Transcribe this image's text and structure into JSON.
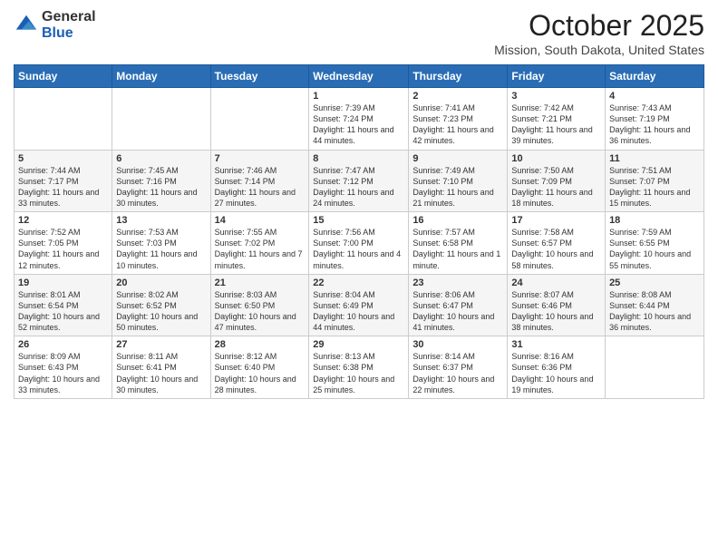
{
  "header": {
    "logo_general": "General",
    "logo_blue": "Blue",
    "month_title": "October 2025",
    "location": "Mission, South Dakota, United States"
  },
  "days_of_week": [
    "Sunday",
    "Monday",
    "Tuesday",
    "Wednesday",
    "Thursday",
    "Friday",
    "Saturday"
  ],
  "weeks": [
    [
      {
        "num": "",
        "info": ""
      },
      {
        "num": "",
        "info": ""
      },
      {
        "num": "",
        "info": ""
      },
      {
        "num": "1",
        "info": "Sunrise: 7:39 AM\nSunset: 7:24 PM\nDaylight: 11 hours and 44 minutes."
      },
      {
        "num": "2",
        "info": "Sunrise: 7:41 AM\nSunset: 7:23 PM\nDaylight: 11 hours and 42 minutes."
      },
      {
        "num": "3",
        "info": "Sunrise: 7:42 AM\nSunset: 7:21 PM\nDaylight: 11 hours and 39 minutes."
      },
      {
        "num": "4",
        "info": "Sunrise: 7:43 AM\nSunset: 7:19 PM\nDaylight: 11 hours and 36 minutes."
      }
    ],
    [
      {
        "num": "5",
        "info": "Sunrise: 7:44 AM\nSunset: 7:17 PM\nDaylight: 11 hours and 33 minutes."
      },
      {
        "num": "6",
        "info": "Sunrise: 7:45 AM\nSunset: 7:16 PM\nDaylight: 11 hours and 30 minutes."
      },
      {
        "num": "7",
        "info": "Sunrise: 7:46 AM\nSunset: 7:14 PM\nDaylight: 11 hours and 27 minutes."
      },
      {
        "num": "8",
        "info": "Sunrise: 7:47 AM\nSunset: 7:12 PM\nDaylight: 11 hours and 24 minutes."
      },
      {
        "num": "9",
        "info": "Sunrise: 7:49 AM\nSunset: 7:10 PM\nDaylight: 11 hours and 21 minutes."
      },
      {
        "num": "10",
        "info": "Sunrise: 7:50 AM\nSunset: 7:09 PM\nDaylight: 11 hours and 18 minutes."
      },
      {
        "num": "11",
        "info": "Sunrise: 7:51 AM\nSunset: 7:07 PM\nDaylight: 11 hours and 15 minutes."
      }
    ],
    [
      {
        "num": "12",
        "info": "Sunrise: 7:52 AM\nSunset: 7:05 PM\nDaylight: 11 hours and 12 minutes."
      },
      {
        "num": "13",
        "info": "Sunrise: 7:53 AM\nSunset: 7:03 PM\nDaylight: 11 hours and 10 minutes."
      },
      {
        "num": "14",
        "info": "Sunrise: 7:55 AM\nSunset: 7:02 PM\nDaylight: 11 hours and 7 minutes."
      },
      {
        "num": "15",
        "info": "Sunrise: 7:56 AM\nSunset: 7:00 PM\nDaylight: 11 hours and 4 minutes."
      },
      {
        "num": "16",
        "info": "Sunrise: 7:57 AM\nSunset: 6:58 PM\nDaylight: 11 hours and 1 minute."
      },
      {
        "num": "17",
        "info": "Sunrise: 7:58 AM\nSunset: 6:57 PM\nDaylight: 10 hours and 58 minutes."
      },
      {
        "num": "18",
        "info": "Sunrise: 7:59 AM\nSunset: 6:55 PM\nDaylight: 10 hours and 55 minutes."
      }
    ],
    [
      {
        "num": "19",
        "info": "Sunrise: 8:01 AM\nSunset: 6:54 PM\nDaylight: 10 hours and 52 minutes."
      },
      {
        "num": "20",
        "info": "Sunrise: 8:02 AM\nSunset: 6:52 PM\nDaylight: 10 hours and 50 minutes."
      },
      {
        "num": "21",
        "info": "Sunrise: 8:03 AM\nSunset: 6:50 PM\nDaylight: 10 hours and 47 minutes."
      },
      {
        "num": "22",
        "info": "Sunrise: 8:04 AM\nSunset: 6:49 PM\nDaylight: 10 hours and 44 minutes."
      },
      {
        "num": "23",
        "info": "Sunrise: 8:06 AM\nSunset: 6:47 PM\nDaylight: 10 hours and 41 minutes."
      },
      {
        "num": "24",
        "info": "Sunrise: 8:07 AM\nSunset: 6:46 PM\nDaylight: 10 hours and 38 minutes."
      },
      {
        "num": "25",
        "info": "Sunrise: 8:08 AM\nSunset: 6:44 PM\nDaylight: 10 hours and 36 minutes."
      }
    ],
    [
      {
        "num": "26",
        "info": "Sunrise: 8:09 AM\nSunset: 6:43 PM\nDaylight: 10 hours and 33 minutes."
      },
      {
        "num": "27",
        "info": "Sunrise: 8:11 AM\nSunset: 6:41 PM\nDaylight: 10 hours and 30 minutes."
      },
      {
        "num": "28",
        "info": "Sunrise: 8:12 AM\nSunset: 6:40 PM\nDaylight: 10 hours and 28 minutes."
      },
      {
        "num": "29",
        "info": "Sunrise: 8:13 AM\nSunset: 6:38 PM\nDaylight: 10 hours and 25 minutes."
      },
      {
        "num": "30",
        "info": "Sunrise: 8:14 AM\nSunset: 6:37 PM\nDaylight: 10 hours and 22 minutes."
      },
      {
        "num": "31",
        "info": "Sunrise: 8:16 AM\nSunset: 6:36 PM\nDaylight: 10 hours and 19 minutes."
      },
      {
        "num": "",
        "info": ""
      }
    ]
  ]
}
